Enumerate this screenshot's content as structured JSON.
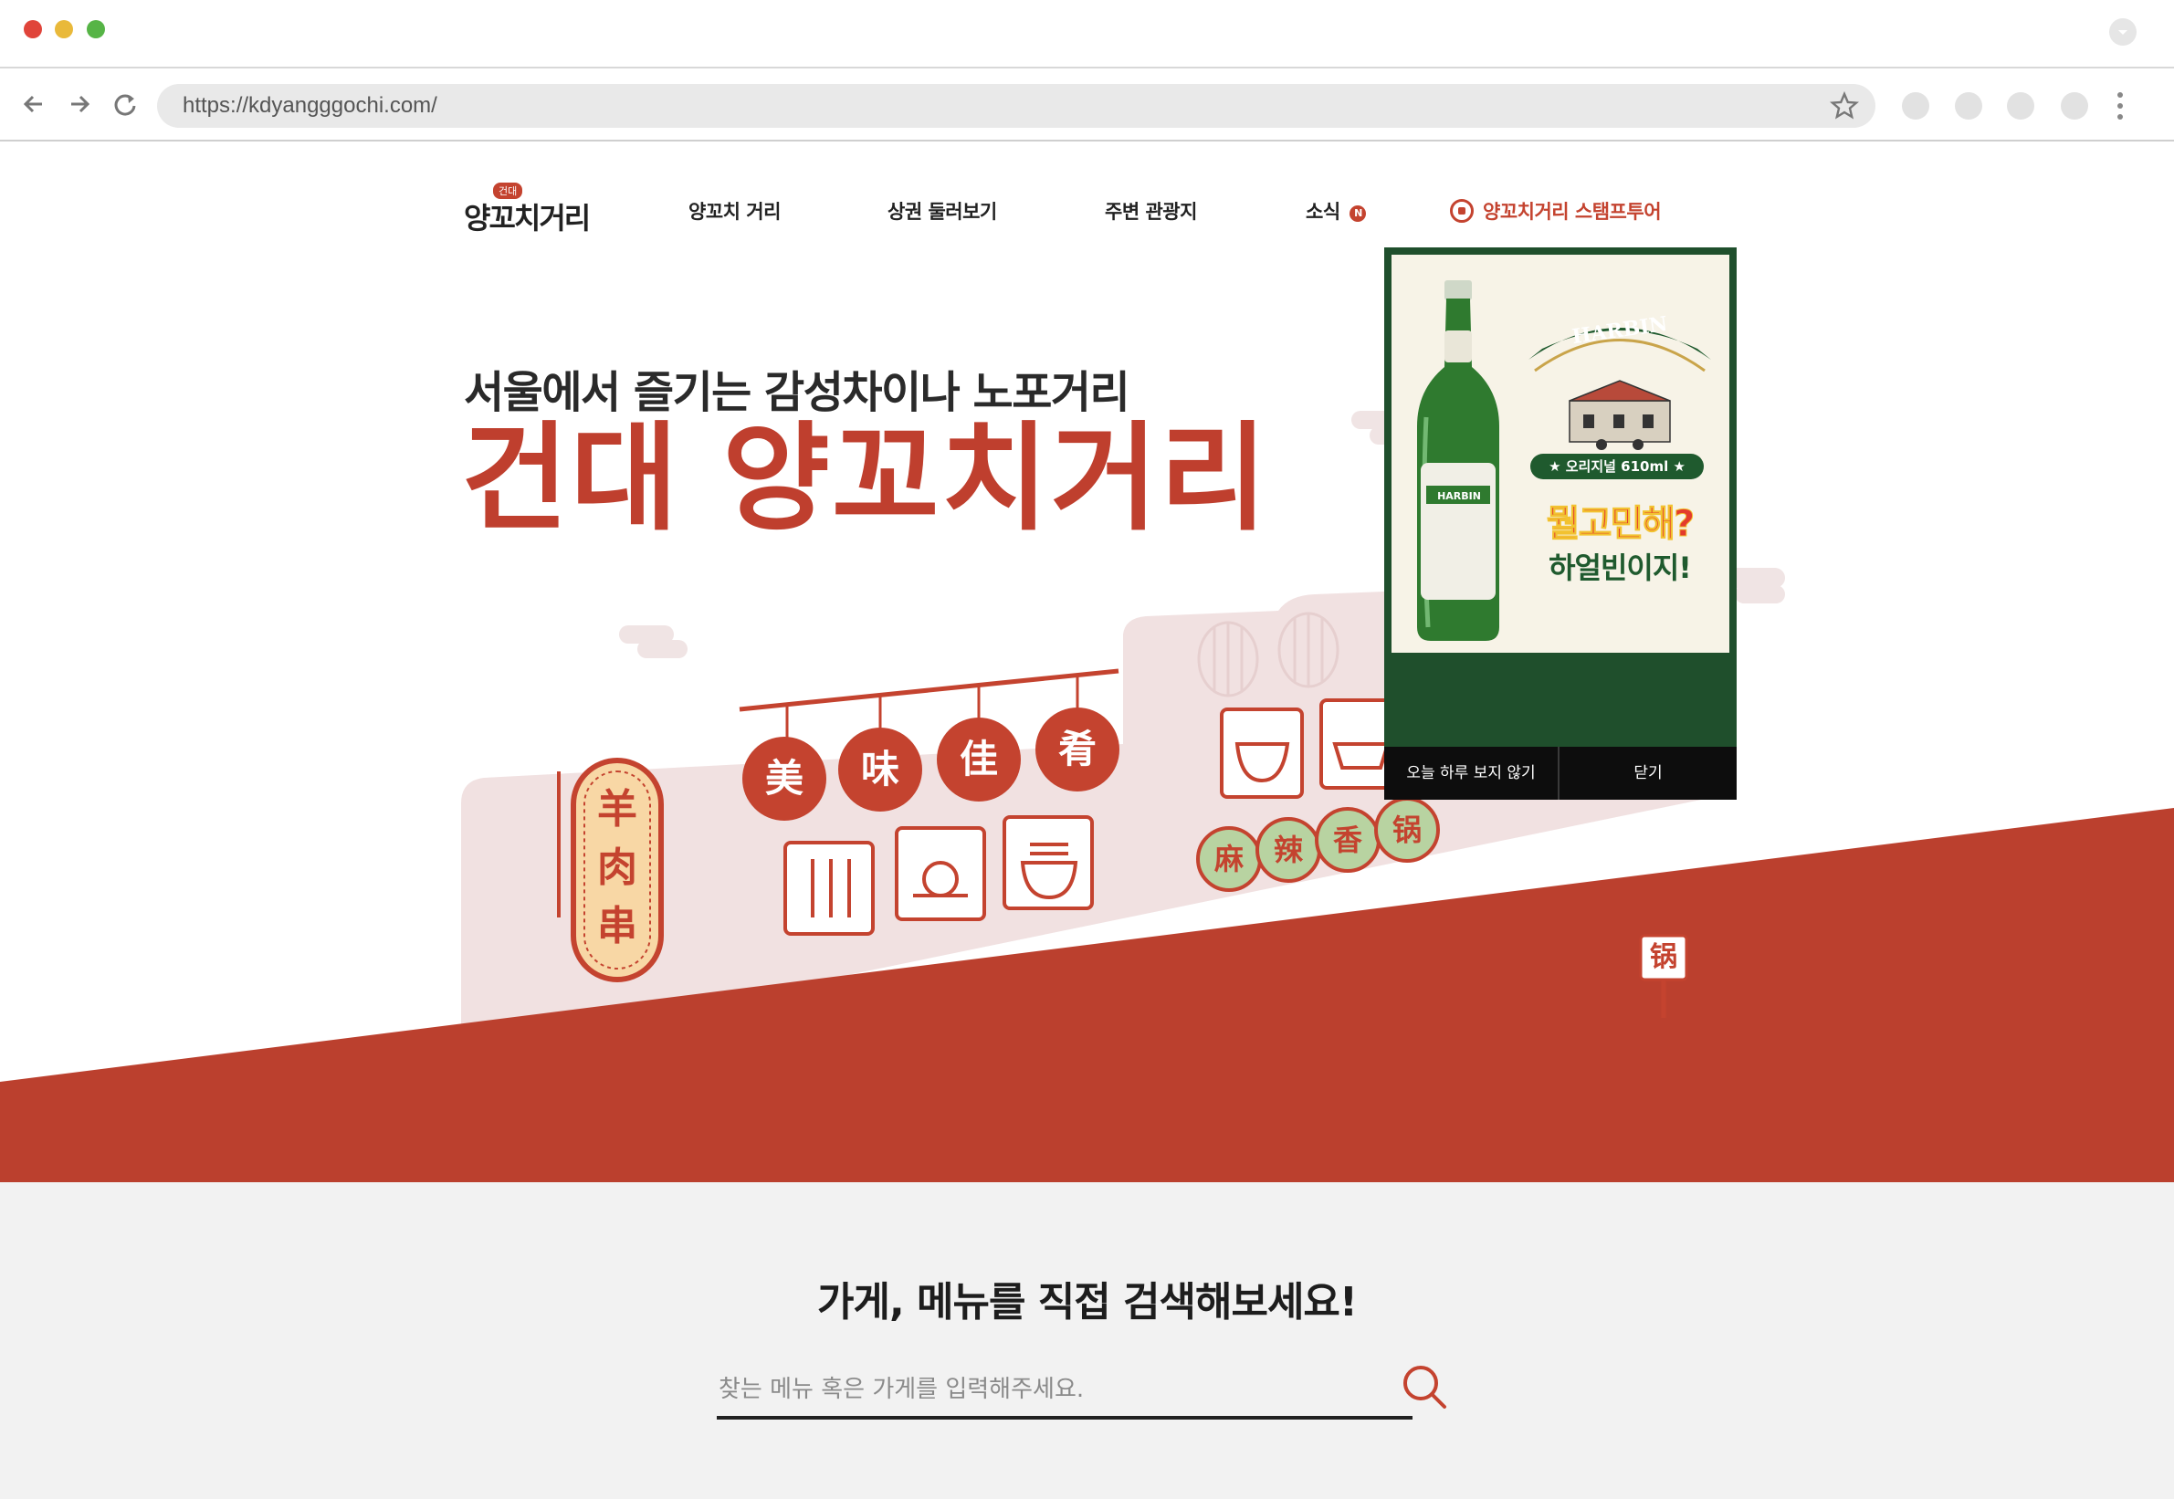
{
  "browser": {
    "url": "https://kdyangggochi.com/",
    "traffic_lights": [
      "#e0443a",
      "#e9b93a",
      "#56b446"
    ]
  },
  "nav": {
    "logo_text": "양꼬치거리",
    "logo_badge": "건대",
    "items": [
      {
        "label": "양꼬치 거리"
      },
      {
        "label": "상권 둘러보기"
      },
      {
        "label": "주변 관광지"
      },
      {
        "label": "소식",
        "badge": "N"
      }
    ],
    "stamp_tour": {
      "label": "양꼬치거리 스탬프투어"
    }
  },
  "hero": {
    "subtitle": "서울에서 즐기는 감성차이나 노포거리",
    "title": "건대 양꼬치거리",
    "lantern_chars": [
      "美",
      "味",
      "佳",
      "肴"
    ],
    "vertical_sign": [
      "羊",
      "肉",
      "串"
    ],
    "round_signs": [
      "麻",
      "辣",
      "香",
      "锅"
    ],
    "small_sign": "锅"
  },
  "search": {
    "title": "가게, 메뉴를 직접 검색해보세요!",
    "placeholder": "찾는 메뉴 혹은 가게를 입력해주세요."
  },
  "popup": {
    "brand": "HARBIN",
    "volume": "★ 오리지널 610ml ★",
    "line1": "뭘고민해?",
    "line2": "하얼빈이지!",
    "bottle_label": "HARBIN",
    "buttons": {
      "hide_today": "오늘 하루 보지 않기",
      "close": "닫기"
    }
  },
  "colors": {
    "brand_red": "#bf3f2e",
    "popup_green": "#1f4f2c",
    "search_bg": "#f2f2f2"
  }
}
